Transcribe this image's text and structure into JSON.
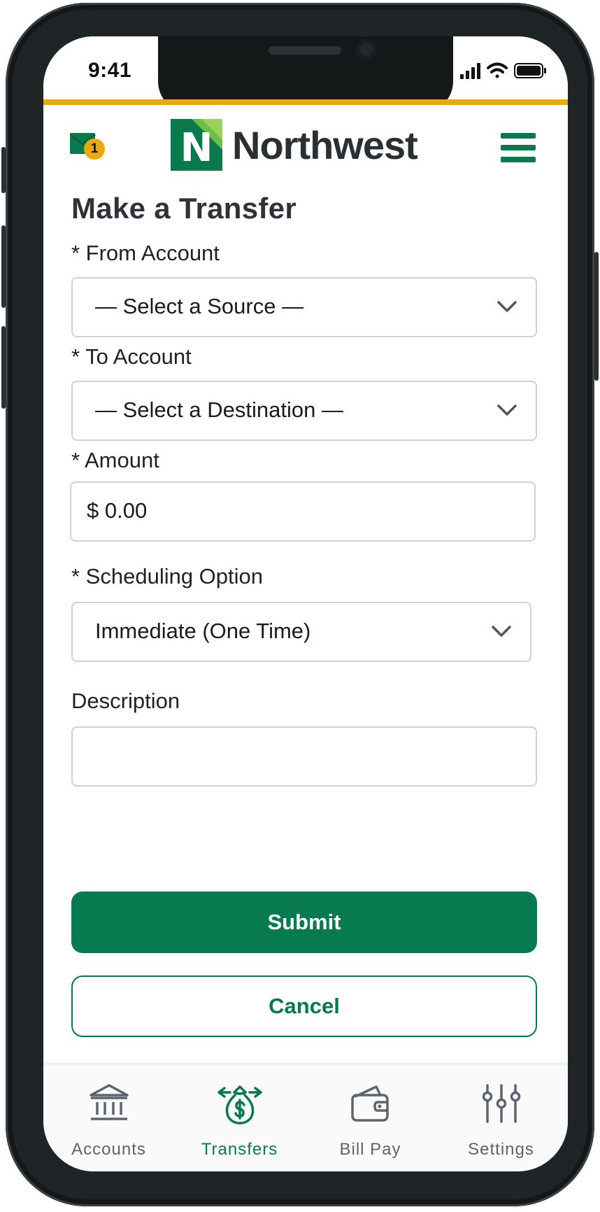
{
  "status_bar": {
    "time": "9:41"
  },
  "header": {
    "brand_name": "Northwest",
    "logo_letter": "N",
    "mail_badge_count": "1",
    "accent_color": "#0a7a4c",
    "stripe_color": "#e8a90c"
  },
  "page": {
    "title": "Make a Transfer"
  },
  "form": {
    "from_account": {
      "label": "* From Account",
      "value": "— Select a Source —"
    },
    "to_account": {
      "label": "* To Account",
      "value": "— Select a Destination —"
    },
    "amount": {
      "label": "* Amount",
      "value": "$ 0.00"
    },
    "scheduling": {
      "label": "* Scheduling Option",
      "value": "Immediate (One Time)"
    },
    "description": {
      "label": "Description",
      "value": ""
    }
  },
  "buttons": {
    "submit": "Submit",
    "cancel": "Cancel"
  },
  "tabs": [
    {
      "label": "Accounts",
      "icon": "bank-icon",
      "active": false
    },
    {
      "label": "Transfers",
      "icon": "money-bag-transfer-icon",
      "active": true
    },
    {
      "label": "Bill Pay",
      "icon": "wallet-icon",
      "active": false
    },
    {
      "label": "Settings",
      "icon": "sliders-icon",
      "active": false
    }
  ]
}
